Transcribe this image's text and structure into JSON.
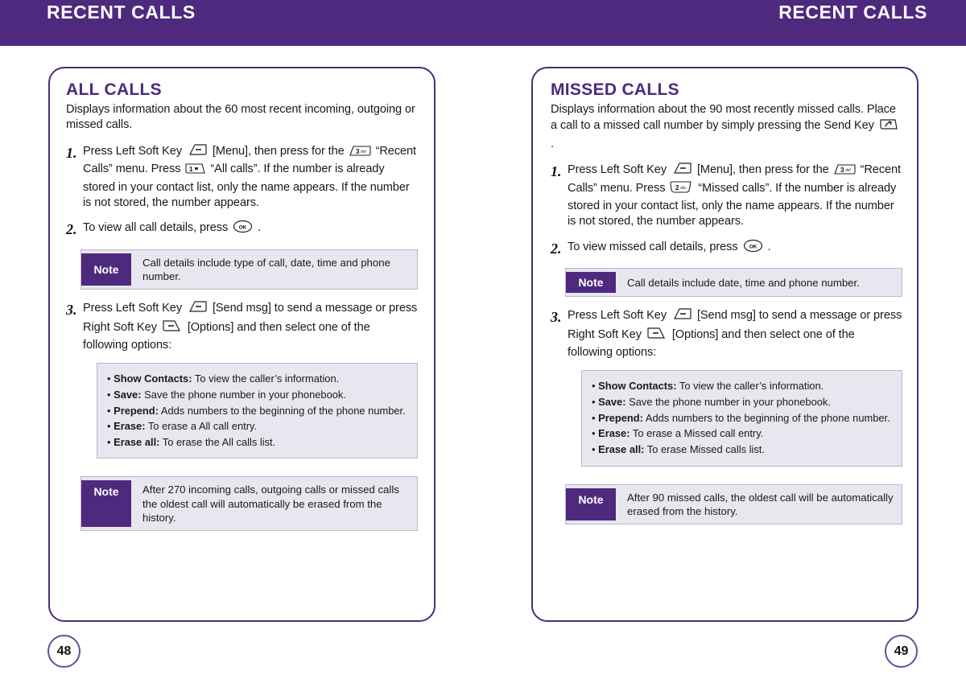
{
  "header": {
    "left_title": "RECENT CALLS",
    "right_title": "RECENT CALLS"
  },
  "left_page": {
    "number": "48",
    "section_title": "ALL CALLS",
    "intro": "Displays information about the 60 most recent incoming, outgoing or missed calls.",
    "steps": [
      {
        "num": "1.",
        "text_parts": {
          "p1": "Press Left Soft Key",
          "icon1": "left-soft-key-icon",
          "p2": "[Menu], then press for the",
          "icon2": "key-3-def-icon",
          "p3": "“Recent Calls” menu. Press",
          "icon3": "key-1-icon",
          "p4": "“All calls”. If the number is already stored in your contact list, only the name appears. If the number is not stored, the number appears."
        }
      },
      {
        "num": "2.",
        "text_parts": {
          "p1": "To view all call details, press",
          "icon1": "ok-key-icon",
          "p2": "."
        }
      },
      {
        "num": "3.",
        "text_parts": {
          "p1": "Press Left Soft Key",
          "icon1": "left-soft-key-icon",
          "p2": "[Send msg] to send a message or press Right Soft Key",
          "icon2": "right-soft-key-icon",
          "p3": "[Options] and then select one of the following options:"
        }
      }
    ],
    "note1": {
      "tag": "Note",
      "text": "Call details include type of call, date, time and phone number."
    },
    "note2": {
      "tag": "Note",
      "text": "After 270 incoming calls, outgoing calls or missed calls the oldest call will automatically be erased from the history."
    },
    "options": [
      {
        "bullet": "•",
        "label": "Show Contacts:",
        "desc": "To view the caller’s information."
      },
      {
        "bullet": "•",
        "label": "Save:",
        "desc": "Save the phone number in your phonebook."
      },
      {
        "bullet": "•",
        "label": "Prepend:",
        "desc": "Adds numbers to the beginning of the phone number."
      },
      {
        "bullet": "•",
        "label": "Erase:",
        "desc": "To erase a All call entry."
      },
      {
        "bullet": "•",
        "label": "Erase all:",
        "desc": "To erase the All calls list."
      }
    ]
  },
  "right_page": {
    "number": "49",
    "section_title": "MISSED CALLS",
    "intro_parts": {
      "p1": "Displays information about the 90 most recently missed calls. Place a call to a missed call number by simply pressing the Send Key",
      "icon1": "send-key-icon",
      "p2": "."
    },
    "steps": [
      {
        "num": "1.",
        "text_parts": {
          "p1": "Press Left Soft Key",
          "icon1": "left-soft-key-icon",
          "p2": "[Menu], then press for the",
          "icon2": "key-3-def-icon",
          "p3": "“Recent Calls” menu. Press",
          "icon3": "key-2-abc-icon",
          "p4": "“Missed calls”. If the number is already stored in your contact list, only the name appears. If the number is not stored, the number appears."
        }
      },
      {
        "num": "2.",
        "text_parts": {
          "p1": "To view missed call details, press",
          "icon1": "ok-key-icon",
          "p2": "."
        }
      },
      {
        "num": "3.",
        "text_parts": {
          "p1": "Press Left Soft Key",
          "icon1": "left-soft-key-icon",
          "p2": "[Send msg] to send a message or press Right Soft Key",
          "icon2": "right-soft-key-icon",
          "p3": "[Options] and then select one of the following options:"
        }
      }
    ],
    "note1": {
      "tag": "Note",
      "text": "Call details include date, time and phone number."
    },
    "note2": {
      "tag": "Note",
      "text": "After 90 missed calls, the oldest call will be automatically erased from the history."
    },
    "options": [
      {
        "bullet": "•",
        "label": "Show Contacts:",
        "desc": "To view the caller’s information."
      },
      {
        "bullet": "•",
        "label": "Save:",
        "desc": "Save the phone number in your phonebook."
      },
      {
        "bullet": "•",
        "label": "Prepend:",
        "desc": "Adds numbers to the beginning of the phone number."
      },
      {
        "bullet": "•",
        "label": "Erase:",
        "desc": "To erase a Missed call entry."
      },
      {
        "bullet": "•",
        "label": "Erase all:",
        "desc": "To erase Missed calls list."
      }
    ]
  },
  "colors": {
    "brand_purple": "#4d2a7e",
    "note_bg": "#e8e6ee",
    "note_border": "#bdb5d0",
    "page_circle_border": "#6b4a9c"
  },
  "key_labels": {
    "key1_digit": "1",
    "key1_sub": "▫",
    "key2_digit": "2",
    "key2_sub": "abc",
    "key3_digit": "3",
    "key3_sub": "def",
    "ok": "OK"
  }
}
